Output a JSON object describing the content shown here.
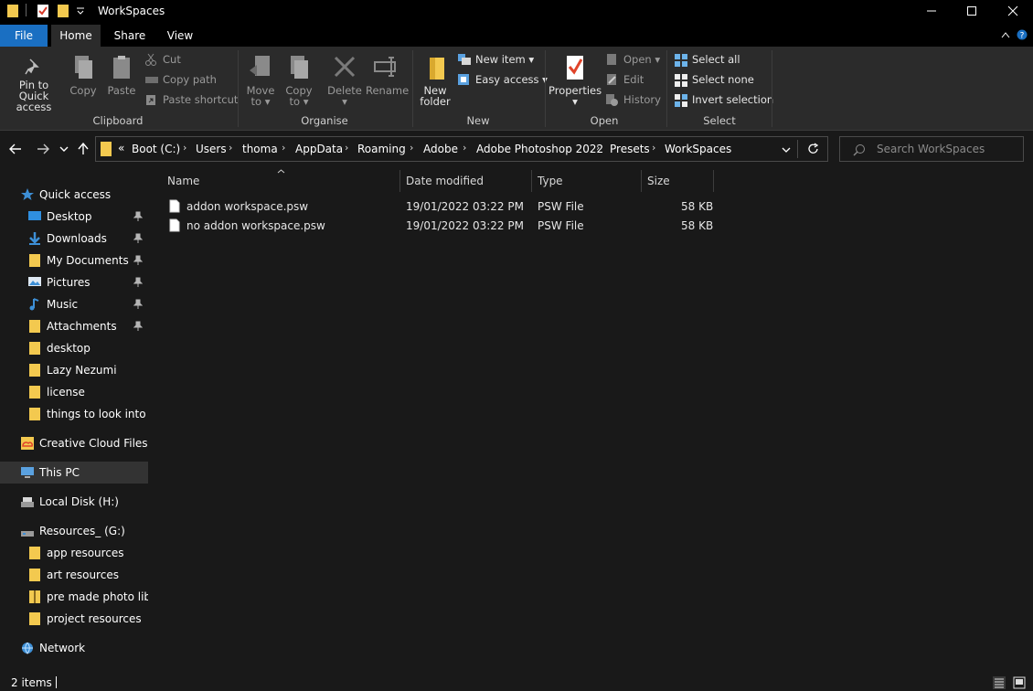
{
  "window": {
    "title": "WorkSpaces"
  },
  "tabs": {
    "file": "File",
    "home": "Home",
    "share": "Share",
    "view": "View"
  },
  "ribbon": {
    "clipboard": {
      "pin_line1": "Pin to Quick",
      "pin_line2": "access",
      "copy": "Copy",
      "paste": "Paste",
      "cut": "Cut",
      "copy_path": "Copy path",
      "paste_shortcut": "Paste shortcut",
      "label": "Clipboard"
    },
    "organise": {
      "move_line1": "Move",
      "move_line2": "to",
      "copy_line1": "Copy",
      "copy_line2": "to",
      "delete": "Delete",
      "rename": "Rename",
      "label": "Organise"
    },
    "new": {
      "folder_line1": "New",
      "folder_line2": "folder",
      "new_item": "New item",
      "easy_access": "Easy access",
      "label": "New"
    },
    "open": {
      "properties": "Properties",
      "open": "Open",
      "edit": "Edit",
      "history": "History",
      "label": "Open"
    },
    "select": {
      "select_all": "Select all",
      "select_none": "Select none",
      "invert": "Invert selection",
      "label": "Select"
    }
  },
  "address": {
    "overflow": "«",
    "crumbs": [
      "Boot (C:)",
      "Users",
      "thoma",
      "AppData",
      "Roaming",
      "Adobe",
      "Adobe Photoshop 2022",
      "Presets",
      "WorkSpaces"
    ]
  },
  "search": {
    "placeholder": "Search WorkSpaces"
  },
  "nav": {
    "quick_access": "Quick access",
    "quick": [
      "Desktop",
      "Downloads",
      "My Documents",
      "Pictures",
      "Music",
      "Attachments",
      "desktop",
      "Lazy Nezumi",
      "license",
      "things to look into"
    ],
    "creative_cloud": "Creative Cloud Files",
    "this_pc": "This PC",
    "local_disk": "Local Disk (H:)",
    "resources": "Resources_ (G:)",
    "resources_items": [
      "app resources",
      "art resources",
      "pre made photo libra",
      "project resources"
    ],
    "network": "Network"
  },
  "columns": {
    "name": "Name",
    "date": "Date modified",
    "type": "Type",
    "size": "Size"
  },
  "files": [
    {
      "name": "addon workspace.psw",
      "date": "19/01/2022 03:22 PM",
      "type": "PSW File",
      "size": "58 KB"
    },
    {
      "name": "no addon workspace.psw",
      "date": "19/01/2022 03:22 PM",
      "type": "PSW File",
      "size": "58 KB"
    }
  ],
  "status": {
    "count": "2 items"
  },
  "colors": {
    "accent": "#1a6fc2",
    "folder": "#f3c94f",
    "bg": "#191919",
    "ribbon": "#2b2b2b"
  }
}
